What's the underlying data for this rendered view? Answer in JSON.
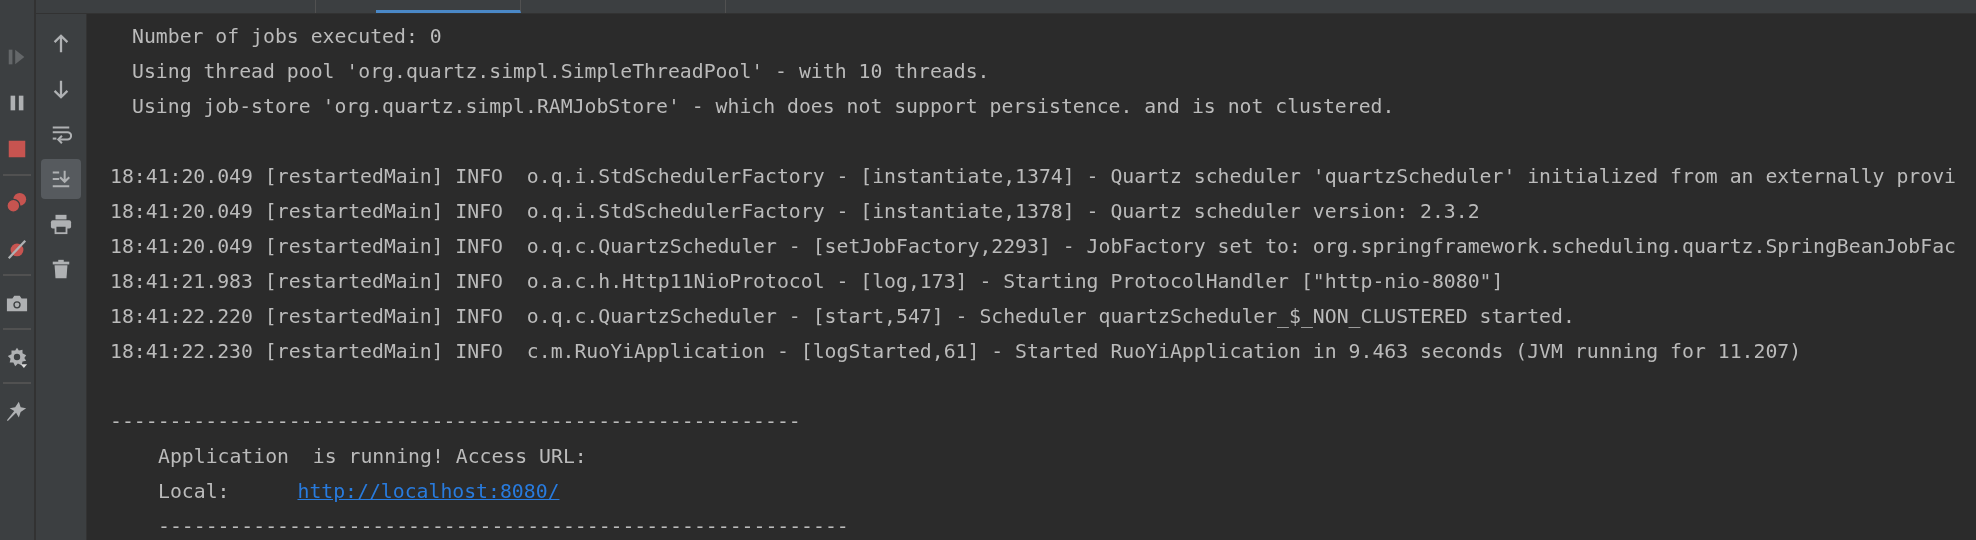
{
  "left_toolbar": [
    {
      "kind": "rerun",
      "disabled": true
    },
    {
      "kind": "pause",
      "disabled": false
    },
    {
      "kind": "stop",
      "disabled": false
    },
    {
      "kind": "sep"
    },
    {
      "kind": "breakpoints",
      "disabled": false
    },
    {
      "kind": "mute",
      "disabled": false
    },
    {
      "kind": "sep"
    },
    {
      "kind": "camera",
      "disabled": false
    },
    {
      "kind": "sep"
    },
    {
      "kind": "gear",
      "disabled": false
    },
    {
      "kind": "sep"
    },
    {
      "kind": "pin",
      "disabled": false
    }
  ],
  "console_toolbar": [
    {
      "kind": "up",
      "selected": false
    },
    {
      "kind": "down",
      "selected": false
    },
    {
      "kind": "wrap",
      "selected": false
    },
    {
      "kind": "scroll_end",
      "selected": true
    },
    {
      "kind": "print",
      "selected": false
    },
    {
      "kind": "trash",
      "selected": false
    }
  ],
  "tabs": [
    {
      "selected": false
    },
    {
      "selected": true
    },
    {
      "selected": false
    }
  ],
  "console": [
    {
      "kind": "summary",
      "text": "Number of jobs executed: 0"
    },
    {
      "kind": "summary",
      "text": "Using thread pool 'org.quartz.simpl.SimpleThreadPool' - with 10 threads."
    },
    {
      "kind": "summary",
      "text": "Using job-store 'org.quartz.simpl.RAMJobStore' - which does not support persistence. and is not clustered."
    },
    {
      "kind": "blank"
    },
    {
      "kind": "log",
      "text": "18:41:20.049 [restartedMain] INFO  o.q.i.StdSchedulerFactory - [instantiate,1374] - Quartz scheduler 'quartzScheduler' initialized from an externally provi"
    },
    {
      "kind": "log",
      "text": "18:41:20.049 [restartedMain] INFO  o.q.i.StdSchedulerFactory - [instantiate,1378] - Quartz scheduler version: 2.3.2"
    },
    {
      "kind": "log",
      "text": "18:41:20.049 [restartedMain] INFO  o.q.c.QuartzScheduler - [setJobFactory,2293] - JobFactory set to: org.springframework.scheduling.quartz.SpringBeanJobFac"
    },
    {
      "kind": "log",
      "text": "18:41:21.983 [restartedMain] INFO  o.a.c.h.Http11NioProtocol - [log,173] - Starting ProtocolHandler [\"http-nio-8080\"]"
    },
    {
      "kind": "log",
      "text": "18:41:22.220 [restartedMain] INFO  o.q.c.QuartzScheduler - [start,547] - Scheduler quartzScheduler_$_NON_CLUSTERED started."
    },
    {
      "kind": "log",
      "text": "18:41:22.230 [restartedMain] INFO  c.m.RuoYiApplication - [logStarted,61] - Started RuoYiApplication in 9.463 seconds (JVM running for 11.207)"
    },
    {
      "kind": "blank"
    },
    {
      "kind": "log",
      "text": "----------------------------------------------------------"
    },
    {
      "kind": "banner",
      "text": "Application  is running! Access URL:"
    },
    {
      "kind": "url",
      "text": "Local:",
      "link": "http://localhost:8080/"
    },
    {
      "kind": "banner",
      "text": "----------------------------------------------------------"
    }
  ]
}
